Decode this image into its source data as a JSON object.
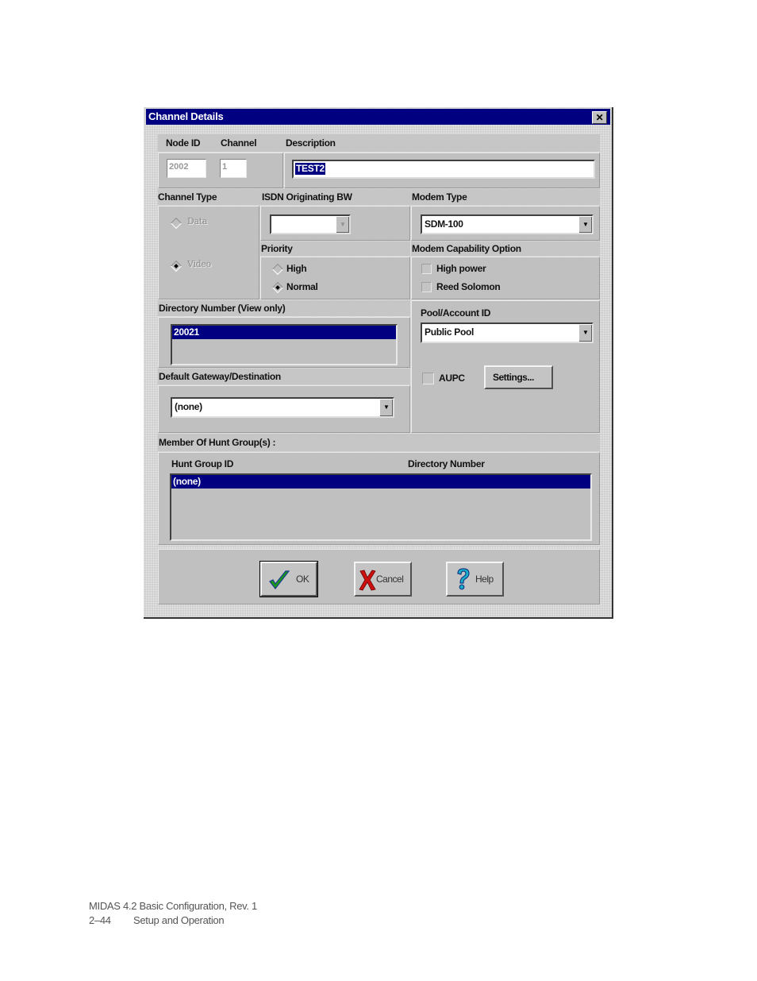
{
  "dialog": {
    "title": "Channel Details",
    "close_icon": "close-x-icon",
    "header_labels": {
      "node_id": "Node ID",
      "channel": "Channel",
      "description": "Description"
    },
    "node_id_value": "2002",
    "channel_value": "1",
    "description_value": "TEST2",
    "channel_type": {
      "label": "Channel Type",
      "options": [
        {
          "label": "Data",
          "selected": false,
          "enabled": false
        },
        {
          "label": "Video",
          "selected": true,
          "enabled": false
        }
      ]
    },
    "isdn_originating_bw": {
      "label": "ISDN Originating BW",
      "value": ""
    },
    "modem_type": {
      "label": "Modem Type",
      "value": "SDM-100"
    },
    "priority": {
      "label": "Priority",
      "options": [
        {
          "label": "High",
          "selected": false
        },
        {
          "label": "Normal",
          "selected": true
        }
      ]
    },
    "modem_capability": {
      "label": "Modem Capability Option",
      "options": [
        {
          "label": "High power",
          "checked": false
        },
        {
          "label": "Reed Solomon",
          "checked": false
        }
      ]
    },
    "directory_number": {
      "label": "Directory Number (View only)",
      "items": [
        "20021"
      ]
    },
    "pool_account": {
      "label": "Pool/Account ID",
      "value": "Public Pool"
    },
    "aupc": {
      "label": "AUPC",
      "checked": false,
      "settings_button": "Settings..."
    },
    "default_gateway": {
      "label": "Default Gateway/Destination",
      "value": "(none)"
    },
    "hunt_groups": {
      "label": "Member Of Hunt Group(s) :",
      "columns": [
        "Hunt Group ID",
        "Directory Number"
      ],
      "rows": [
        "(none)"
      ]
    },
    "buttons": {
      "ok": "OK",
      "cancel": "Cancel",
      "help": "Help"
    }
  },
  "footer": {
    "line1": "MIDAS 4.2 Basic Configuration,  Rev. 1",
    "page": "2–44",
    "section": "Setup and Operation"
  }
}
